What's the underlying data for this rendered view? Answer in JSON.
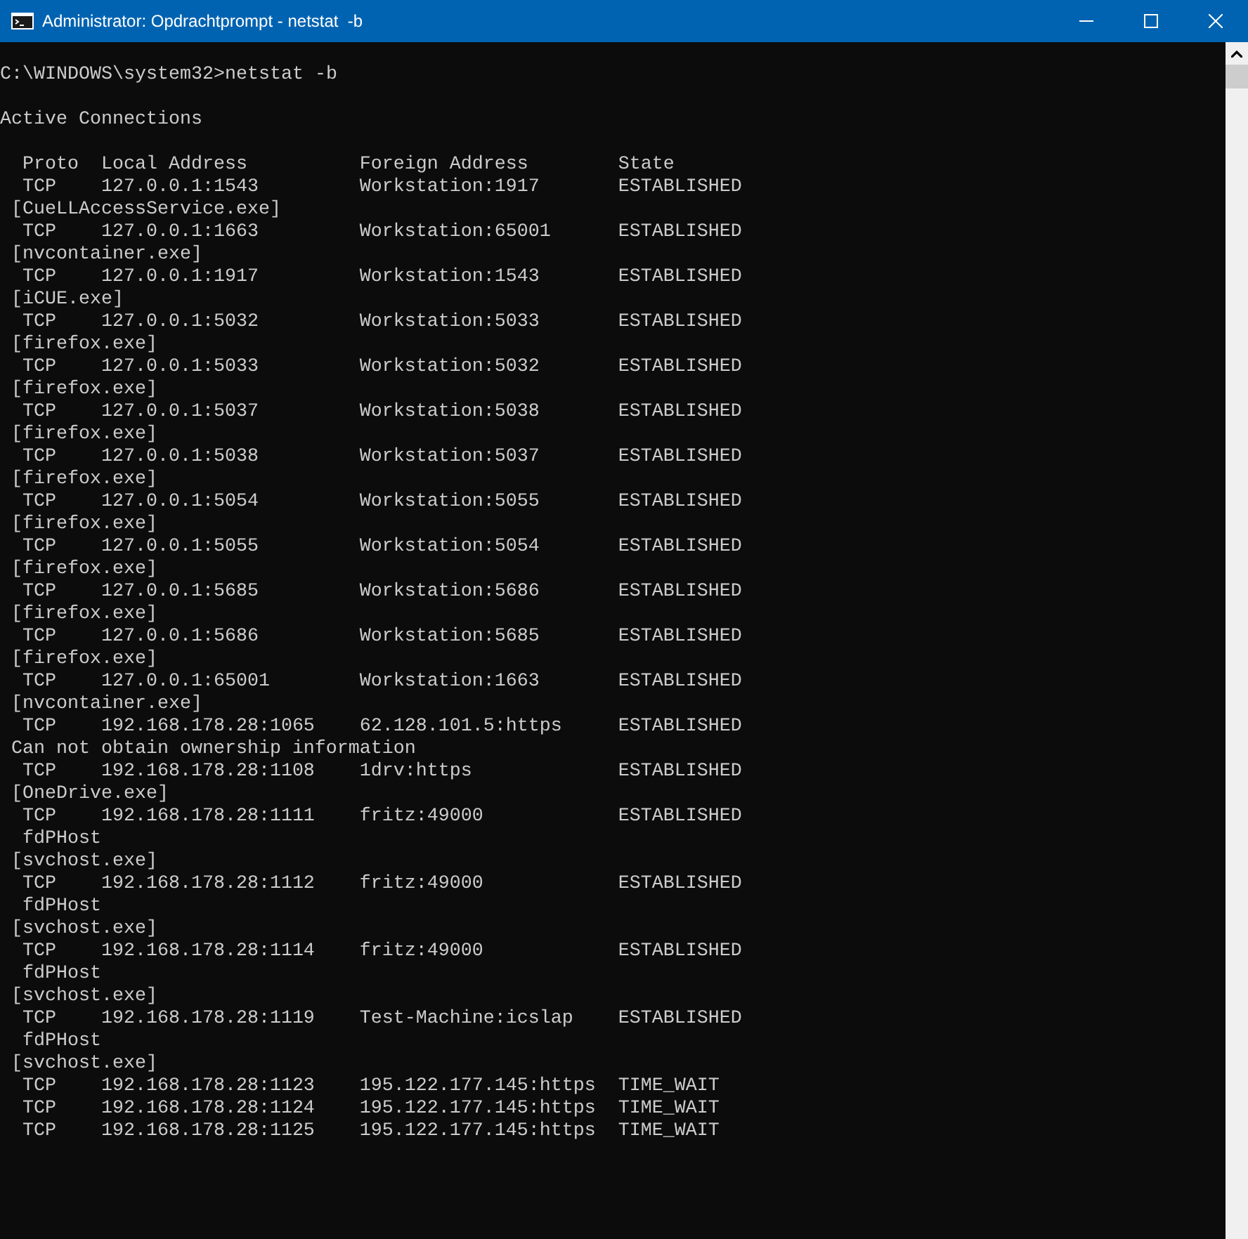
{
  "window": {
    "title": "Administrator: Opdrachtprompt - netstat  -b"
  },
  "console": {
    "prompt": "C:\\WINDOWS\\system32>netstat -b",
    "heading": "Active Connections",
    "columns": [
      "Proto",
      "Local Address",
      "Foreign Address",
      "State"
    ],
    "connections": [
      {
        "proto": "TCP",
        "local_address": "127.0.0.1:1543",
        "foreign_address": "Workstation:1917",
        "state": "ESTABLISHED",
        "owner": [
          {
            "kind": "executable",
            "text": "[CueLLAccessService.exe]"
          }
        ]
      },
      {
        "proto": "TCP",
        "local_address": "127.0.0.1:1663",
        "foreign_address": "Workstation:65001",
        "state": "ESTABLISHED",
        "owner": [
          {
            "kind": "executable",
            "text": "[nvcontainer.exe]"
          }
        ]
      },
      {
        "proto": "TCP",
        "local_address": "127.0.0.1:1917",
        "foreign_address": "Workstation:1543",
        "state": "ESTABLISHED",
        "owner": [
          {
            "kind": "executable",
            "text": "[iCUE.exe]"
          }
        ]
      },
      {
        "proto": "TCP",
        "local_address": "127.0.0.1:5032",
        "foreign_address": "Workstation:5033",
        "state": "ESTABLISHED",
        "owner": [
          {
            "kind": "executable",
            "text": "[firefox.exe]"
          }
        ]
      },
      {
        "proto": "TCP",
        "local_address": "127.0.0.1:5033",
        "foreign_address": "Workstation:5032",
        "state": "ESTABLISHED",
        "owner": [
          {
            "kind": "executable",
            "text": "[firefox.exe]"
          }
        ]
      },
      {
        "proto": "TCP",
        "local_address": "127.0.0.1:5037",
        "foreign_address": "Workstation:5038",
        "state": "ESTABLISHED",
        "owner": [
          {
            "kind": "executable",
            "text": "[firefox.exe]"
          }
        ]
      },
      {
        "proto": "TCP",
        "local_address": "127.0.0.1:5038",
        "foreign_address": "Workstation:5037",
        "state": "ESTABLISHED",
        "owner": [
          {
            "kind": "executable",
            "text": "[firefox.exe]"
          }
        ]
      },
      {
        "proto": "TCP",
        "local_address": "127.0.0.1:5054",
        "foreign_address": "Workstation:5055",
        "state": "ESTABLISHED",
        "owner": [
          {
            "kind": "executable",
            "text": "[firefox.exe]"
          }
        ]
      },
      {
        "proto": "TCP",
        "local_address": "127.0.0.1:5055",
        "foreign_address": "Workstation:5054",
        "state": "ESTABLISHED",
        "owner": [
          {
            "kind": "executable",
            "text": "[firefox.exe]"
          }
        ]
      },
      {
        "proto": "TCP",
        "local_address": "127.0.0.1:5685",
        "foreign_address": "Workstation:5686",
        "state": "ESTABLISHED",
        "owner": [
          {
            "kind": "executable",
            "text": "[firefox.exe]"
          }
        ]
      },
      {
        "proto": "TCP",
        "local_address": "127.0.0.1:5686",
        "foreign_address": "Workstation:5685",
        "state": "ESTABLISHED",
        "owner": [
          {
            "kind": "executable",
            "text": "[firefox.exe]"
          }
        ]
      },
      {
        "proto": "TCP",
        "local_address": "127.0.0.1:65001",
        "foreign_address": "Workstation:1663",
        "state": "ESTABLISHED",
        "owner": [
          {
            "kind": "executable",
            "text": "[nvcontainer.exe]"
          }
        ]
      },
      {
        "proto": "TCP",
        "local_address": "192.168.178.28:1065",
        "foreign_address": "62.128.101.5:https",
        "state": "ESTABLISHED",
        "owner": [
          {
            "kind": "message",
            "text": "Can not obtain ownership information"
          }
        ]
      },
      {
        "proto": "TCP",
        "local_address": "192.168.178.28:1108",
        "foreign_address": "1drv:https",
        "state": "ESTABLISHED",
        "owner": [
          {
            "kind": "executable",
            "text": "[OneDrive.exe]"
          }
        ]
      },
      {
        "proto": "TCP",
        "local_address": "192.168.178.28:1111",
        "foreign_address": "fritz:49000",
        "state": "ESTABLISHED",
        "owner": [
          {
            "kind": "component",
            "text": "fdPHost"
          },
          {
            "kind": "executable",
            "text": "[svchost.exe]"
          }
        ]
      },
      {
        "proto": "TCP",
        "local_address": "192.168.178.28:1112",
        "foreign_address": "fritz:49000",
        "state": "ESTABLISHED",
        "owner": [
          {
            "kind": "component",
            "text": "fdPHost"
          },
          {
            "kind": "executable",
            "text": "[svchost.exe]"
          }
        ]
      },
      {
        "proto": "TCP",
        "local_address": "192.168.178.28:1114",
        "foreign_address": "fritz:49000",
        "state": "ESTABLISHED",
        "owner": [
          {
            "kind": "component",
            "text": "fdPHost"
          },
          {
            "kind": "executable",
            "text": "[svchost.exe]"
          }
        ]
      },
      {
        "proto": "TCP",
        "local_address": "192.168.178.28:1119",
        "foreign_address": "Test-Machine:icslap",
        "state": "ESTABLISHED",
        "owner": [
          {
            "kind": "component",
            "text": "fdPHost"
          },
          {
            "kind": "executable",
            "text": "[svchost.exe]"
          }
        ]
      },
      {
        "proto": "TCP",
        "local_address": "192.168.178.28:1123",
        "foreign_address": "195.122.177.145:https",
        "state": "TIME_WAIT"
      },
      {
        "proto": "TCP",
        "local_address": "192.168.178.28:1124",
        "foreign_address": "195.122.177.145:https",
        "state": "TIME_WAIT"
      },
      {
        "proto": "TCP",
        "local_address": "192.168.178.28:1125",
        "foreign_address": "195.122.177.145:https",
        "state": "TIME_WAIT"
      }
    ]
  }
}
